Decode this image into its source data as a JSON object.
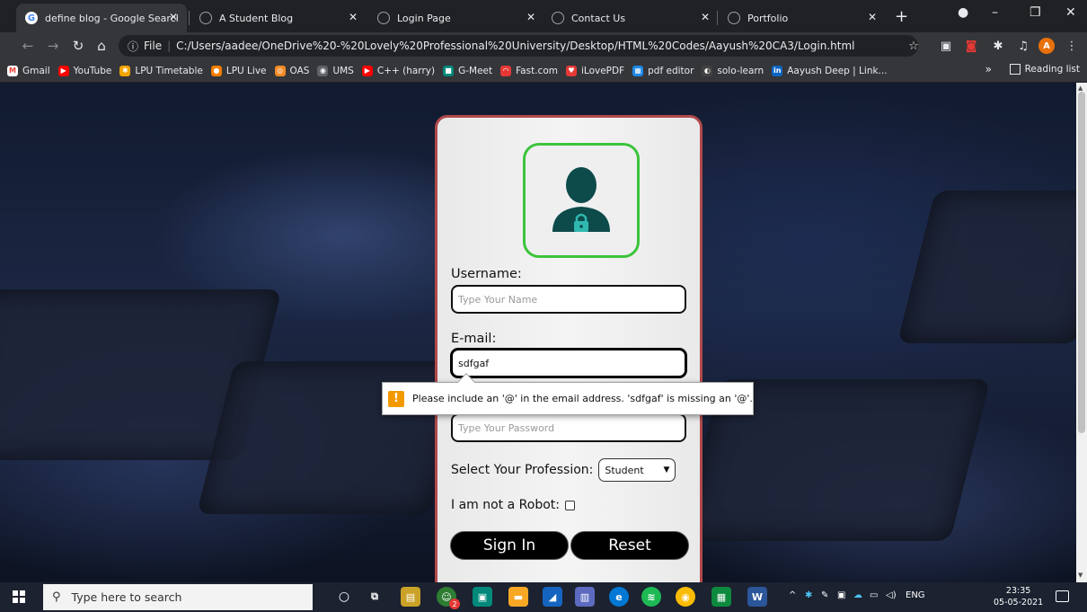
{
  "browser": {
    "tabs": [
      {
        "title": "define blog - Google Search",
        "color": "#4285f4"
      },
      {
        "title": "A Student Blog",
        "color": "#9aa0a6"
      },
      {
        "title": "Login Page",
        "color": "#9aa0a6"
      },
      {
        "title": "Contact Us",
        "color": "#9aa0a6"
      },
      {
        "title": "Portfolio",
        "color": "#9aa0a6"
      }
    ],
    "new_tab_label": "+",
    "omnibox": {
      "scheme_label": "File",
      "url": "C:/Users/aadee/OneDrive%20-%20Lovely%20Professional%20University/Desktop/HTML%20Codes/Aayush%20CA3/Login.html"
    },
    "profile_initial": "A"
  },
  "bookmarks": [
    {
      "label": "Gmail",
      "color": "#ea4335",
      "glyph": "M"
    },
    {
      "label": "YouTube",
      "color": "#ff0000",
      "glyph": "▶"
    },
    {
      "label": "LPU Timetable",
      "color": "#f4a400",
      "glyph": "✱"
    },
    {
      "label": "LPU Live",
      "color": "#f57c00",
      "glyph": "●"
    },
    {
      "label": "OAS",
      "color": "#f08a24",
      "glyph": "◎"
    },
    {
      "label": "UMS",
      "color": "#5f6368",
      "glyph": "◉"
    },
    {
      "label": "C++ (harry)",
      "color": "#ff0000",
      "glyph": "▶"
    },
    {
      "label": "G-Meet",
      "color": "#00897b",
      "glyph": "■"
    },
    {
      "label": "Fast.com",
      "color": "#e53935",
      "glyph": "◠"
    },
    {
      "label": "iLovePDF",
      "color": "#e53935",
      "glyph": "♥"
    },
    {
      "label": "pdf editor",
      "color": "#1e88e5",
      "glyph": "▦"
    },
    {
      "label": "solo-learn",
      "color": "#424242",
      "glyph": "◐"
    },
    {
      "label": "Aayush Deep | Link...",
      "color": "#0a66c2",
      "glyph": "in"
    }
  ],
  "bookmarks_more": "»",
  "reading_list": "Reading list",
  "form": {
    "username_label": "Username:",
    "username_placeholder": "Type Your Name",
    "email_label": "E-mail:",
    "email_value": "sdfgaf",
    "password_placeholder": "Type Your Password",
    "profession_label": "Select Your Profession:",
    "profession_selected": "Student",
    "robot_label": "I am not a Robot:",
    "robot_checked": false,
    "signin_label": "Sign In",
    "reset_label": "Reset"
  },
  "validation": {
    "icon": "!",
    "message": "Please include an '@' in the email address. 'sdfgaf' is missing an '@'."
  },
  "taskbar": {
    "search_placeholder": "Type here to search",
    "language": "ENG",
    "time": "23:35",
    "date": "05-05-2021",
    "badge_count": "2"
  },
  "colors": {
    "card_border": "#b14a4a",
    "avatar_border": "#3cc43c",
    "avatar_icon": "#0d4a4a",
    "lock": "#2fb8b0",
    "warning": "#f29900"
  }
}
